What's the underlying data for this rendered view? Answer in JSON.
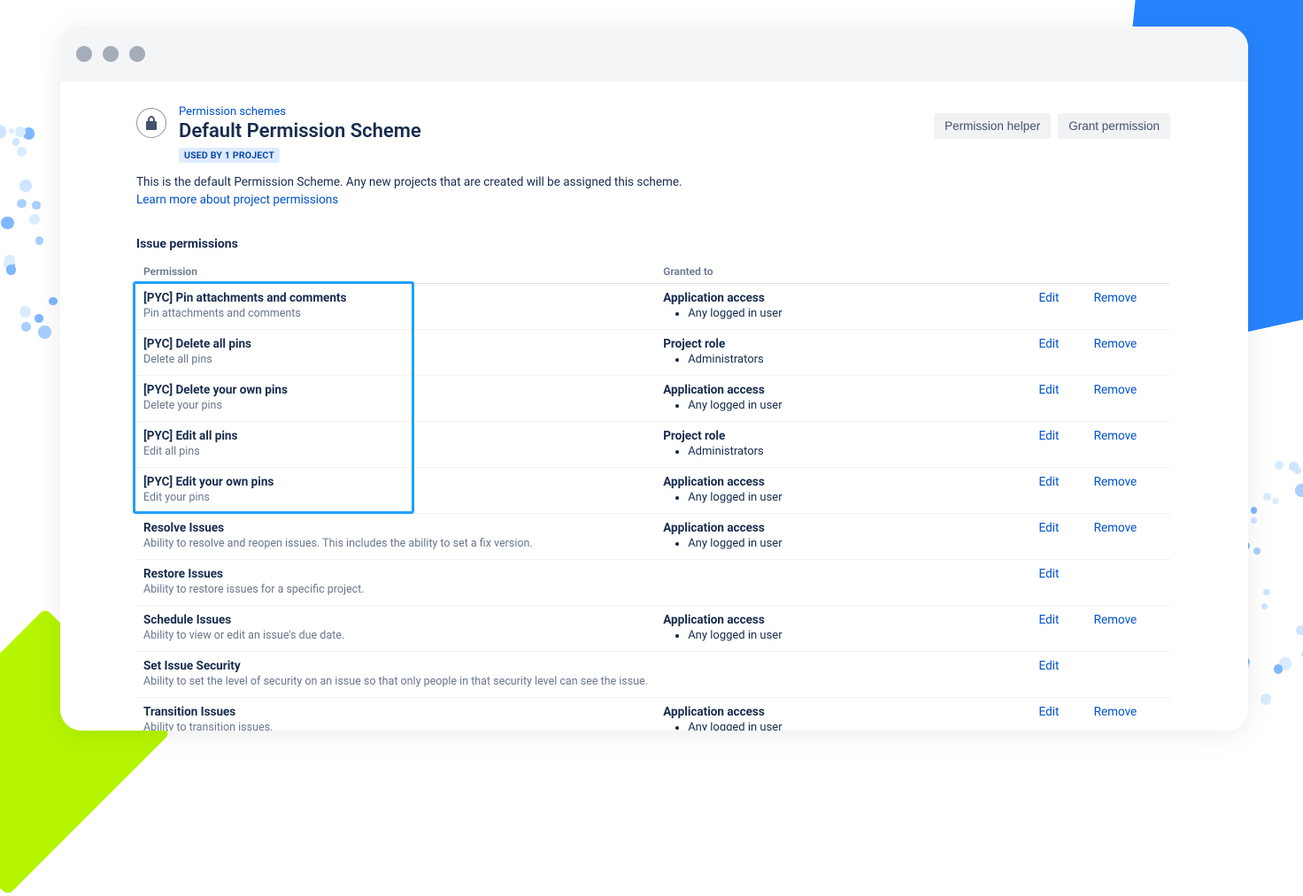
{
  "breadcrumb": "Permission schemes",
  "title": "Default Permission Scheme",
  "lozenge": "USED BY 1 PROJECT",
  "description": "This is the default Permission Scheme. Any new projects that are created will be assigned this scheme.",
  "learn_link": "Learn more about project permissions",
  "btn_helper": "Permission helper",
  "btn_grant": "Grant permission",
  "section_title": "Issue permissions",
  "col_permission": "Permission",
  "col_granted": "Granted to",
  "label_edit": "Edit",
  "label_remove": "Remove",
  "rows": [
    {
      "name": "[PYC] Pin attachments and comments",
      "desc": "Pin attachments and comments",
      "grant_title": "Application access",
      "grant_item": "Any logged in user",
      "edit": true,
      "remove": true
    },
    {
      "name": "[PYC] Delete all pins",
      "desc": "Delete all pins",
      "grant_title": "Project role",
      "grant_item": "Administrators",
      "edit": true,
      "remove": true
    },
    {
      "name": "[PYC] Delete your own pins",
      "desc": "Delete your pins",
      "grant_title": "Application access",
      "grant_item": "Any logged in user",
      "edit": true,
      "remove": true
    },
    {
      "name": "[PYC] Edit all pins",
      "desc": "Edit all pins",
      "grant_title": "Project role",
      "grant_item": "Administrators",
      "edit": true,
      "remove": true
    },
    {
      "name": "[PYC] Edit your own pins",
      "desc": "Edit your pins",
      "grant_title": "Application access",
      "grant_item": "Any logged in user",
      "edit": true,
      "remove": true
    },
    {
      "name": "Resolve Issues",
      "desc": "Ability to resolve and reopen issues. This includes the ability to set a fix version.",
      "grant_title": "Application access",
      "grant_item": "Any logged in user",
      "edit": true,
      "remove": true
    },
    {
      "name": "Restore Issues",
      "desc": "Ability to restore issues for a specific project.",
      "grant_title": "",
      "grant_item": "",
      "edit": true,
      "remove": false
    },
    {
      "name": "Schedule Issues",
      "desc": "Ability to view or edit an issue's due date.",
      "grant_title": "Application access",
      "grant_item": "Any logged in user",
      "edit": true,
      "remove": true
    },
    {
      "name": "Set Issue Security",
      "desc": "Ability to set the level of security on an issue so that only people in that security level can see the issue.",
      "grant_title": "",
      "grant_item": "",
      "edit": true,
      "remove": false
    },
    {
      "name": "Transition Issues",
      "desc": "Ability to transition issues.",
      "grant_title": "Application access",
      "grant_item": "Any logged in user",
      "edit": true,
      "remove": true
    }
  ]
}
